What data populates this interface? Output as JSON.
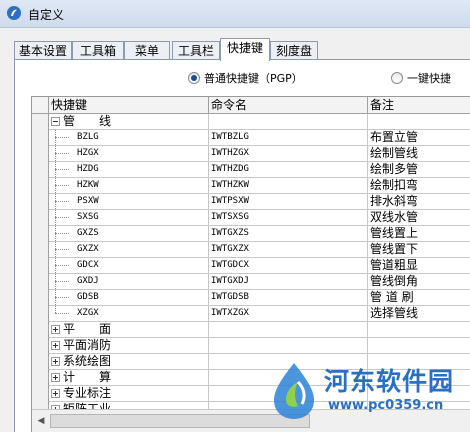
{
  "window": {
    "title": "自定义"
  },
  "tabs": [
    {
      "label": "基本设置",
      "active": false
    },
    {
      "label": "工具箱",
      "active": false
    },
    {
      "label": "菜单",
      "active": false
    },
    {
      "label": "工具栏",
      "active": false
    },
    {
      "label": "快捷键",
      "active": true
    },
    {
      "label": "刻度盘",
      "active": false
    }
  ],
  "mode": {
    "options": [
      {
        "label": "普通快捷键（PGP）",
        "selected": true
      },
      {
        "label": "一键快捷",
        "selected": false
      }
    ]
  },
  "grid": {
    "headers": [
      "快捷键",
      "命令名",
      "备注"
    ],
    "rows": [
      {
        "type": "group",
        "expanded": true,
        "key": "管　　线",
        "cmd": "",
        "note": ""
      },
      {
        "type": "item",
        "key": "BZLG",
        "cmd": "IWTBZLG",
        "note": "布置立管"
      },
      {
        "type": "item",
        "key": "HZGX",
        "cmd": "IWTHZGX",
        "note": "绘制管线"
      },
      {
        "type": "item",
        "key": "HZDG",
        "cmd": "IWTHZDG",
        "note": "绘制多管"
      },
      {
        "type": "item",
        "key": "HZKW",
        "cmd": "IWTHZKW",
        "note": "绘制扣弯"
      },
      {
        "type": "item",
        "key": "PSXW",
        "cmd": "IWTPSXW",
        "note": "排水斜弯"
      },
      {
        "type": "item",
        "key": "SXSG",
        "cmd": "IWTSXSG",
        "note": "双线水管"
      },
      {
        "type": "item",
        "key": "GXZS",
        "cmd": "IWTGXZS",
        "note": "管线置上"
      },
      {
        "type": "item",
        "key": "GXZX",
        "cmd": "IWTGXZX",
        "note": "管线置下"
      },
      {
        "type": "item",
        "key": "GDCX",
        "cmd": "IWTGDCX",
        "note": "管道粗显"
      },
      {
        "type": "item",
        "key": "GXDJ",
        "cmd": "IWTGXDJ",
        "note": "管线倒角"
      },
      {
        "type": "item",
        "key": "GDSB",
        "cmd": "IWTGDSB",
        "note": "管 道 刷"
      },
      {
        "type": "item",
        "key": "XZGX",
        "cmd": "IWTXZGX",
        "note": "选择管线"
      },
      {
        "type": "group",
        "expanded": false,
        "key": "平　　面",
        "cmd": "",
        "note": ""
      },
      {
        "type": "group",
        "expanded": false,
        "key": "平面消防",
        "cmd": "",
        "note": ""
      },
      {
        "type": "group",
        "expanded": false,
        "key": "系统绘图",
        "cmd": "",
        "note": ""
      },
      {
        "type": "group",
        "expanded": false,
        "key": "计　　算",
        "cmd": "",
        "note": ""
      },
      {
        "type": "group",
        "expanded": false,
        "key": "专业标注",
        "cmd": "",
        "note": ""
      },
      {
        "type": "group",
        "expanded": false,
        "key": "矩阵工业",
        "cmd": "",
        "note": ""
      }
    ]
  },
  "watermark": {
    "name": "河东软件园",
    "url": "www.pc0359.cn"
  },
  "colors": {
    "accent": "#2a6fc0",
    "tab_border": "#8c9aae"
  }
}
